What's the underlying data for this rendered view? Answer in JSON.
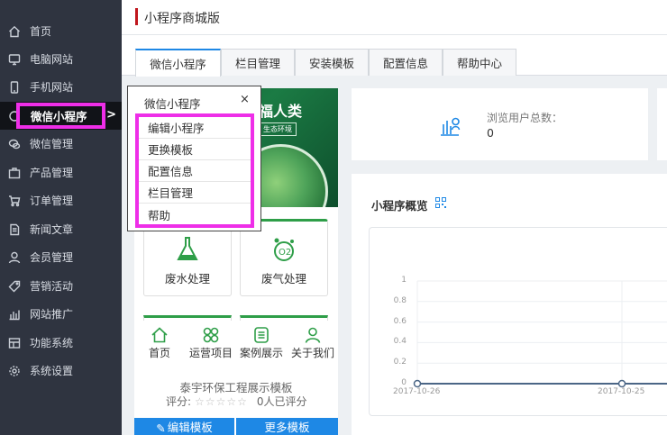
{
  "sidebar": {
    "items": [
      {
        "label": "首页",
        "icon": "home-icon"
      },
      {
        "label": "电脑网站",
        "icon": "monitor-icon"
      },
      {
        "label": "手机网站",
        "icon": "phone-icon"
      },
      {
        "label": "微信小程序",
        "icon": "mini-program-icon",
        "active": true
      },
      {
        "label": "微信管理",
        "icon": "wechat-icon"
      },
      {
        "label": "产品管理",
        "icon": "product-icon"
      },
      {
        "label": "订单管理",
        "icon": "cart-icon"
      },
      {
        "label": "新闻文章",
        "icon": "article-icon"
      },
      {
        "label": "会员管理",
        "icon": "user-icon"
      },
      {
        "label": "营销活动",
        "icon": "tag-icon"
      },
      {
        "label": "网站推广",
        "icon": "bar-chart-icon"
      },
      {
        "label": "功能系统",
        "icon": "module-icon"
      },
      {
        "label": "系统设置",
        "icon": "gear-icon"
      }
    ],
    "active_arrow": ">"
  },
  "header": {
    "title": "小程序商城版"
  },
  "tabs": [
    {
      "label": "微信小程序",
      "active": true
    },
    {
      "label": "栏目管理"
    },
    {
      "label": "安装模板"
    },
    {
      "label": "配置信息"
    },
    {
      "label": "帮助中心"
    }
  ],
  "popup": {
    "title": "微信小程序",
    "close": "×",
    "items": [
      "编辑小程序",
      "更换模板",
      "配置信息",
      "栏目管理",
      "帮助"
    ]
  },
  "preview": {
    "banner_title": "福人类",
    "banner_sub": "生态环境",
    "cards": [
      "废水处理",
      "废气处理"
    ],
    "tabbar": [
      "首页",
      "运营项目",
      "案例展示",
      "关于我们"
    ],
    "template_name": "泰宇环保工程展示模板",
    "rating_label": "评分:",
    "stars": "☆☆☆☆☆",
    "rating_count": "0人已评分",
    "edit_button": "编辑模板",
    "more_button": "更多模板"
  },
  "stats": {
    "label": "浏览用户总数：",
    "value": "0"
  },
  "overview": {
    "title": "小程序概览"
  },
  "chart_data": {
    "type": "line",
    "title": "",
    "xlabel": "",
    "ylabel": "",
    "x": [
      "2017-10-26",
      "2017-10-25"
    ],
    "series": [
      {
        "values": [
          0,
          0
        ]
      }
    ],
    "y_ticks": [
      "0",
      "0.2",
      "0.4",
      "0.6",
      "0.8",
      "1"
    ],
    "ylim": [
      0,
      1
    ],
    "grid": true
  },
  "colors": {
    "sidebar_bg": "#2f3440",
    "accent_blue": "#1e88e5",
    "brand_green": "#2e9e48",
    "highlight_magenta": "#ee2ee8",
    "title_bar_red": "#c0161d"
  }
}
